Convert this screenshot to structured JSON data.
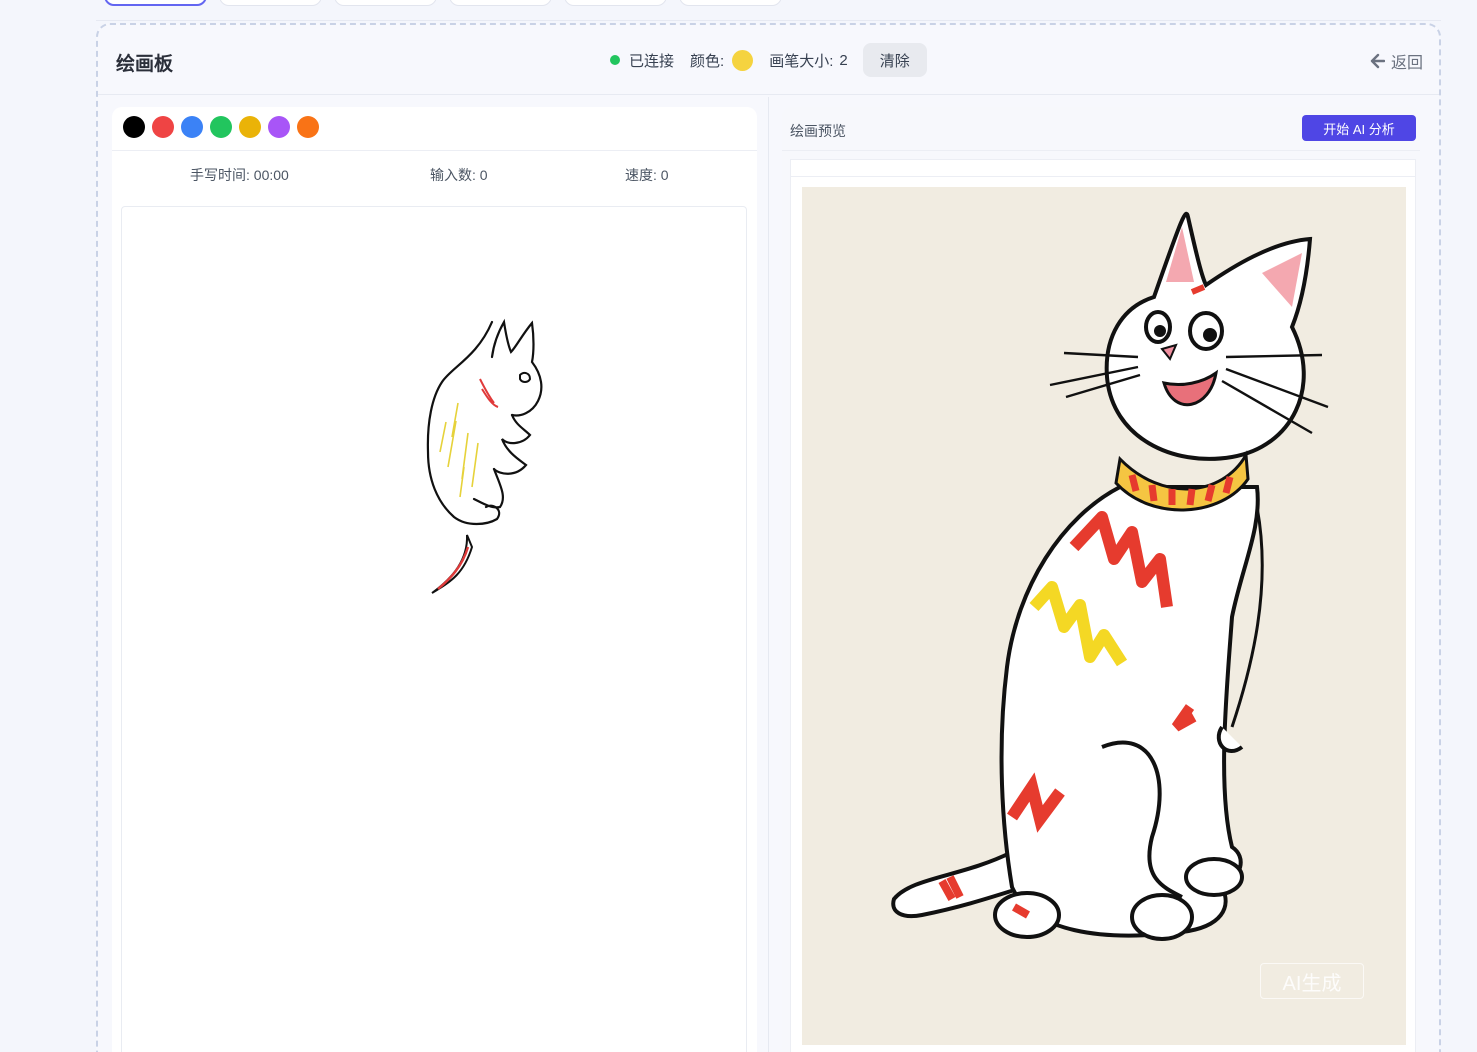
{
  "board": {
    "title": "绘画板",
    "connection_status": "已连接",
    "color_label": "颜色:",
    "current_color": "#f5d33f",
    "brush_size_label": "画笔大小:",
    "brush_size": "2",
    "clear_label": "清除",
    "back_label": "返回"
  },
  "palette": {
    "colors": [
      "#000000",
      "#ef4444",
      "#3b82f6",
      "#22c55e",
      "#eab308",
      "#a855f7",
      "#f97316"
    ]
  },
  "stats": {
    "time_label": "手写时间:",
    "time_value": "00:00",
    "input_label": "输入数:",
    "input_value": "0",
    "speed_label": "速度:",
    "speed_value": "0"
  },
  "preview": {
    "title": "绘画预览",
    "ai_button_label": "开始 AI 分析",
    "watermark": "AI生成"
  },
  "colors": {
    "accent": "#4f46e5",
    "connected": "#22c55e"
  }
}
